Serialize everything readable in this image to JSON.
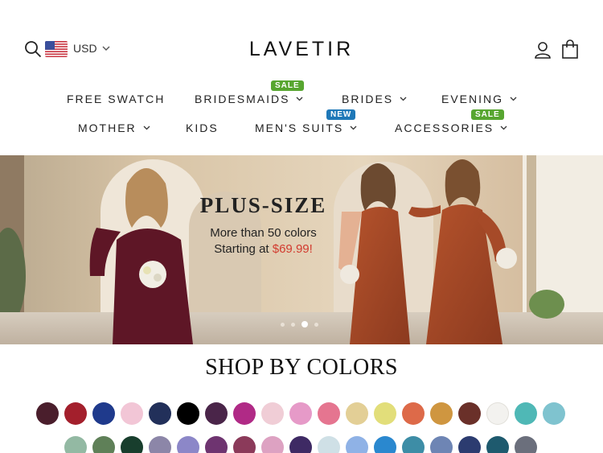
{
  "header": {
    "currency": "USD",
    "logo": "LAVETIR"
  },
  "nav": {
    "row1": [
      {
        "label": "FREE SWATCH",
        "dropdown": false
      },
      {
        "label": "BRIDESMAIDS",
        "dropdown": true,
        "badge": "SALE"
      },
      {
        "label": "BRIDES",
        "dropdown": true
      },
      {
        "label": "EVENING",
        "dropdown": true
      }
    ],
    "row2": [
      {
        "label": "MOTHER",
        "dropdown": true
      },
      {
        "label": "KIDS",
        "dropdown": false
      },
      {
        "label": "MEN'S SUITS",
        "dropdown": true,
        "badge": "NEW"
      },
      {
        "label": "ACCESSORIES",
        "dropdown": true,
        "badge": "SALE"
      }
    ]
  },
  "hero": {
    "title": "PLUS-SIZE",
    "line1": "More than 50 colors",
    "line2_prefix": "Starting at ",
    "price": "$69.99!",
    "slides": 4,
    "active_slide": 3
  },
  "colors_section": {
    "title": "SHOP BY COLORS",
    "row1": [
      "#4a1e2c",
      "#a31f2c",
      "#1f3a8c",
      "#f2c6d6",
      "#22305a",
      "#000000",
      "#4a2549",
      "#b02a86",
      "#f0cdd6",
      "#e69ac8",
      "#e57590",
      "#e3cf96",
      "#e2de7a",
      "#dd6a49",
      "#cf9640",
      "#6a3029",
      "#f3f2ef",
      "#4fb8b6",
      "#7fc3cf"
    ],
    "row2": [
      "#93b9a3",
      "#5f8058",
      "#183e2d",
      "#8c86a8",
      "#8c87c8",
      "#6e3470",
      "#8b3a5a",
      "#dda2c2",
      "#3e2a64",
      "#cfe0e6",
      "#8fb2e6",
      "#2a88cf",
      "#3d8da6",
      "#6e85b4",
      "#2c3c70",
      "#1e5a6e",
      "#6b6f7c"
    ]
  },
  "theme": {
    "sale_badge": "#57a630",
    "new_badge": "#1e78b8",
    "price_red": "#d23b2f"
  }
}
